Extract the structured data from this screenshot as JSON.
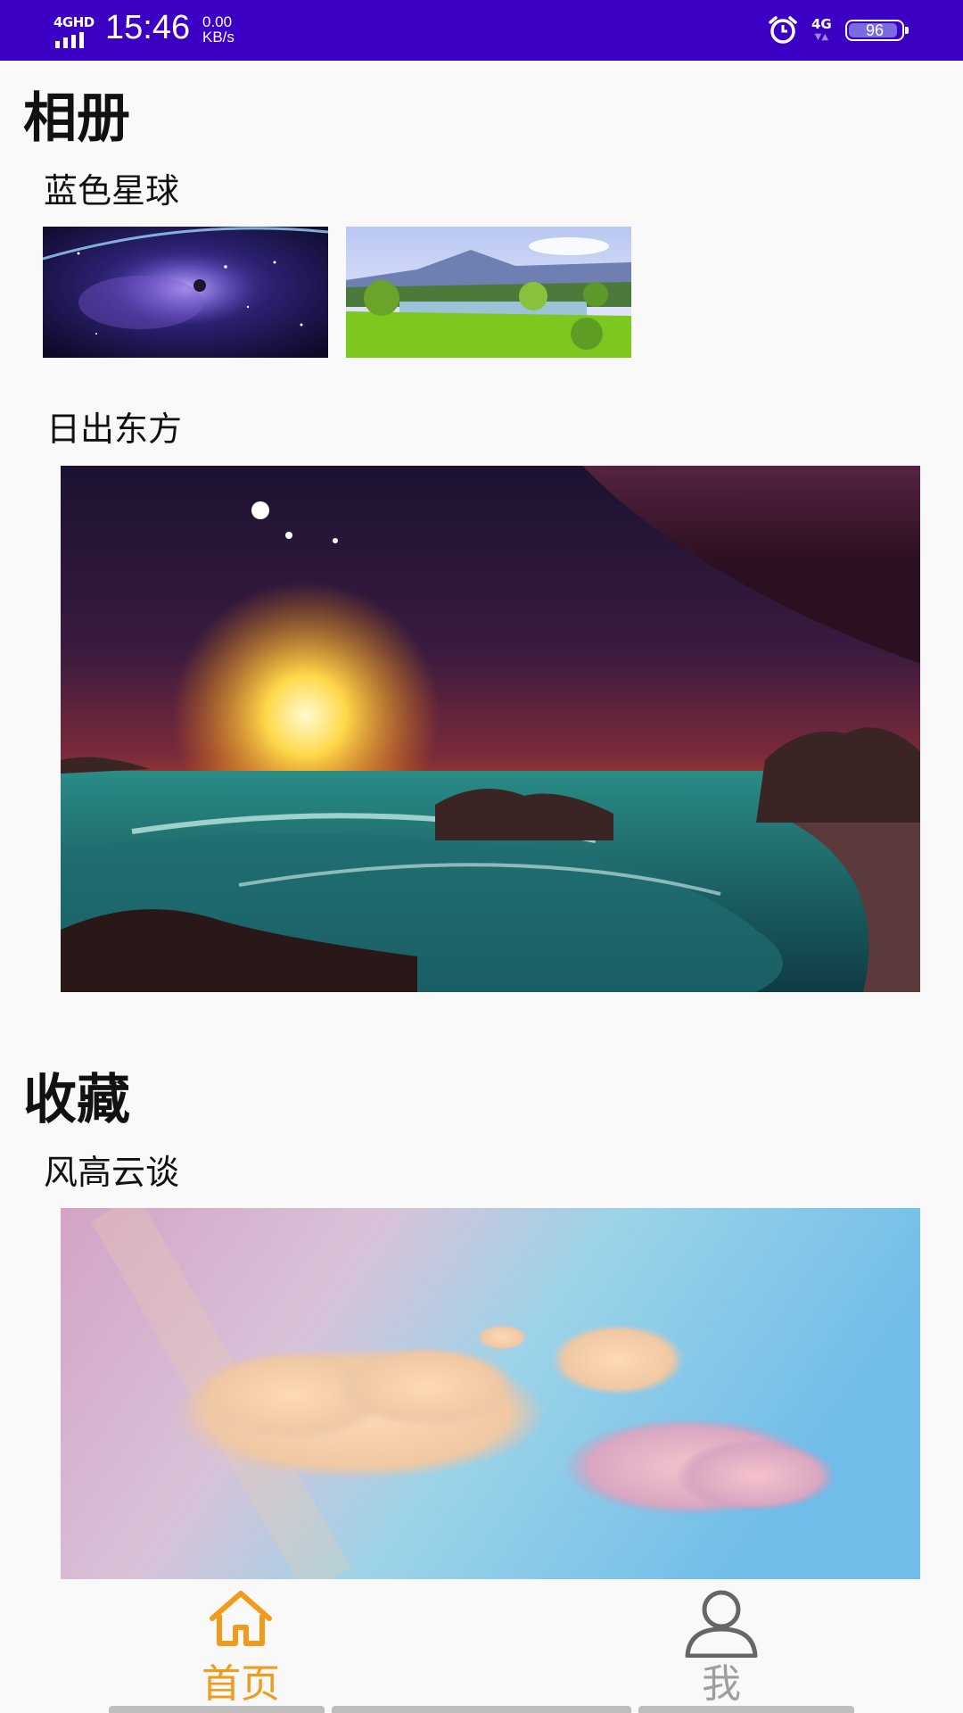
{
  "status_bar": {
    "network": "4GHD",
    "time": "15:46",
    "speed_value": "0.00",
    "speed_unit": "KB/s",
    "network_right": "4G",
    "battery": "96",
    "background_color": "#3b00c4"
  },
  "sections": [
    {
      "title": "相册",
      "albums": [
        {
          "title": "蓝色星球",
          "photos": [
            "galaxy-photo",
            "lake-landscape-photo"
          ]
        },
        {
          "title": "日出东方",
          "photos": [
            "sunrise-beach-planet-photo"
          ]
        }
      ]
    },
    {
      "title": "收藏",
      "albums": [
        {
          "title": "风高云谈",
          "photos": [
            "pastel-sky-clouds-photo"
          ]
        }
      ]
    }
  ],
  "bottom_nav": {
    "items": [
      {
        "label": "首页",
        "icon": "home-icon",
        "active": true,
        "color": "#f29a1a"
      },
      {
        "label": "我",
        "icon": "person-icon",
        "active": false,
        "color": "#9e9e9e"
      }
    ]
  }
}
